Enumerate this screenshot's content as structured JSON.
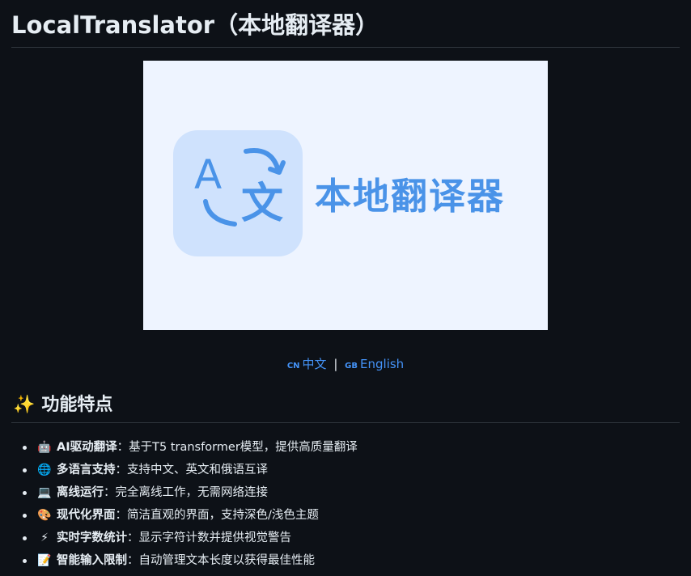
{
  "title": "LocalTranslator（本地翻译器）",
  "banner": {
    "text": "本地翻译器",
    "icon": "translate-icon",
    "colors": {
      "background": "#eef4ff",
      "icon_bg": "#cfe2fd",
      "accent": "#4a93e8"
    }
  },
  "languages": {
    "zh_flag": "CN",
    "zh_label": "中文",
    "separator": "|",
    "en_flag": "GB",
    "en_label": "English"
  },
  "features_heading": {
    "emoji": "✨",
    "text": "功能特点"
  },
  "features": [
    {
      "icon": "robot-icon",
      "emoji": "🤖",
      "name": "AI驱动翻译",
      "desc": "：基于T5 transformer模型，提供高质量翻译"
    },
    {
      "icon": "globe-icon",
      "emoji": "🌐",
      "name": "多语言支持",
      "desc": "：支持中文、英文和俄语互译"
    },
    {
      "icon": "laptop-icon",
      "emoji": "💻",
      "name": "离线运行",
      "desc": "：完全离线工作，无需网络连接"
    },
    {
      "icon": "palette-icon",
      "emoji": "🎨",
      "name": "现代化界面",
      "desc": "：简洁直观的界面，支持深色/浅色主题"
    },
    {
      "icon": "lightning-icon",
      "emoji": "⚡",
      "name": "实时字数统计",
      "desc": "：显示字符计数并提供视觉警告"
    },
    {
      "icon": "memo-icon",
      "emoji": "📝",
      "name": "智能输入限制",
      "desc": "：自动管理文本长度以获得最佳性能"
    }
  ],
  "theme": {
    "page_bg": "#0d1117",
    "text": "#e6edf3",
    "link": "#4493f8",
    "border": "#30363d"
  }
}
